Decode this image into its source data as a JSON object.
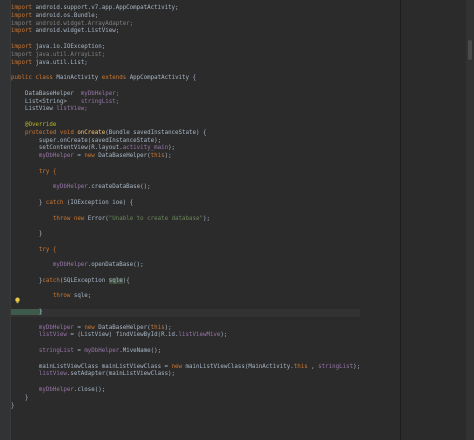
{
  "colors": {
    "background": "#2b2b2b",
    "keyword": "#cc7832",
    "field": "#9876aa",
    "string": "#6a8759",
    "annotation": "#bbb529",
    "text": "#a9b7c6"
  },
  "icons": {
    "bulb": "lightbulb-icon"
  },
  "code": {
    "imports": [
      {
        "kw": "import",
        "rest": " android.support.v7.app.AppCompatActivity;"
      },
      {
        "kw": "import",
        "rest": " android.os.Bundle;"
      },
      {
        "kw": "import",
        "rest": " android.widget.ArrayAdapter;"
      },
      {
        "kw": "import",
        "rest": " android.widget.ListView;"
      },
      {
        "kw": "import",
        "rest": " java.io.IOException;"
      },
      {
        "kw": "import",
        "rest": " java.util.ArrayList;"
      },
      {
        "kw": "import",
        "rest": " java.util.List;"
      }
    ],
    "class_kw": "public class",
    "class_name": " MainActivity ",
    "extends_kw": "extends",
    "class_tail": " AppCompatActivity {",
    "field1_type": "    DataBaseHelper  ",
    "field1_name": "myDbHelper;",
    "field2_type": "    List<String>    ",
    "field2_name": "stringList;",
    "field3_type": "    ListView ",
    "field3_name": "listView;",
    "override": "    @Override",
    "oncreate_kw": "    protected void",
    "oncreate_name": " onCreate",
    "oncreate_tail": "(Bundle savedInstanceState) {",
    "super_call": "        super.onCreate(savedInstanceState);",
    "setcontent_a": "        setContentView(R.layout.",
    "setcontent_b": "activity_main",
    "setcontent_c": ");",
    "helper1_a": "        ",
    "helper1_b": "myDbHelper",
    "helper1_c": " = ",
    "helper1_d": "new",
    "helper1_e": " DataBaseHelper(",
    "helper1_f": "this",
    "helper1_g": ");",
    "try1": "        try {",
    "create_db_a": "            ",
    "create_db_b": "myDbHelper",
    "create_db_c": ".createDataBase();",
    "catch1_a": "        } ",
    "catch1_b": "catch",
    "catch1_c": " (IOException ioe) {",
    "throw1_a": "            ",
    "throw1_b": "throw new",
    "throw1_c": " Error(",
    "throw1_d": "\"Unable to create database\"",
    "throw1_e": ");",
    "close1": "        }",
    "try2": "        try {",
    "open_db_a": "            ",
    "open_db_b": "myDbHelper",
    "open_db_c": ".openDataBase();",
    "catch2_a": "        }",
    "catch2_b": "catch",
    "catch2_c": "(SQLException ",
    "catch2_d": "sqle",
    "catch2_e": "){",
    "throw2_a": "            ",
    "throw2_b": "throw",
    "throw2_c": " sqle;",
    "close2": "        }",
    "helper2_a": "        ",
    "helper2_b": "myDbHelper",
    "helper2_c": " = ",
    "helper2_d": "new",
    "helper2_e": " DataBaseHelper(",
    "helper2_f": "this",
    "helper2_g": ");",
    "listview_a": "        ",
    "listview_b": "listView",
    "listview_c": " = (ListView) findViewById(R.id.",
    "listview_d": "listViewMive",
    "listview_e": ");",
    "stringlist_a": "        ",
    "stringlist_b": "stringList",
    "stringlist_c": " = ",
    "stringlist_d": "myDbHelper",
    "stringlist_e": ".MiveName();",
    "mainlist_a": "        mainListViewClass mainListViewClass = ",
    "mainlist_b": "new",
    "mainlist_c": " mainListViewClass(MainActivity.",
    "mainlist_d": "this",
    "mainlist_e": " , ",
    "mainlist_f": "stringList",
    "mainlist_g": ");",
    "adapter_a": "        ",
    "adapter_b": "listView",
    "adapter_c": ".setAdapter(mainListViewClass);",
    "close_a": "        ",
    "close_b": "myDbHelper",
    "close_c": ".close();",
    "method_close": "    }",
    "class_close": "}"
  }
}
